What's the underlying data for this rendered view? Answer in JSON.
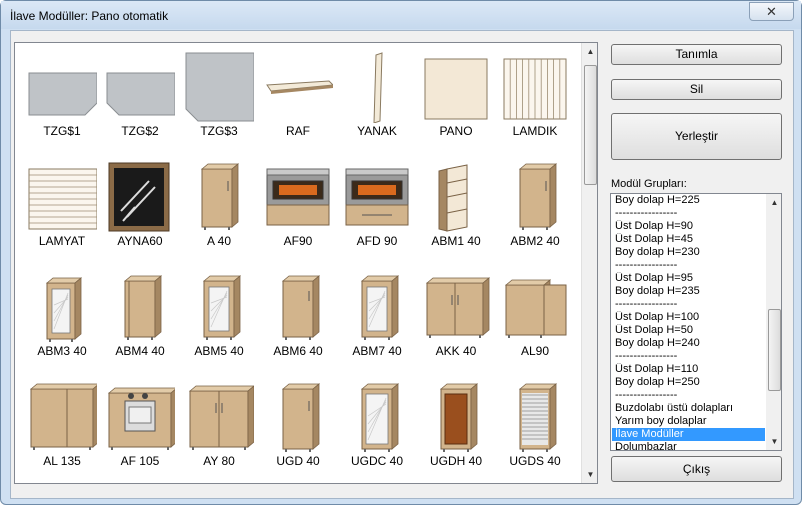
{
  "window": {
    "title": "İlave Modüller:  Pano otomatik",
    "close_glyph": "✕"
  },
  "buttons": {
    "tanimla": "Tanımla",
    "sil": "Sil",
    "yerlestir": "Yerleştir",
    "cikis": "Çıkış"
  },
  "groups": {
    "label": "Modül Grupları:",
    "items": [
      "Boy dolap H=225",
      "-----------------",
      "Üst Dolap H=90",
      "Üst Dolap H=45",
      "Boy dolap H=230",
      "-----------------",
      "Üst Dolap H=95",
      "Boy dolap H=235",
      "-----------------",
      "Üst Dolap H=100",
      "Üst Dolap H=50",
      "Boy dolap H=240",
      "-----------------",
      "Üst Dolap H=110",
      "Boy dolap H=250",
      "-----------------",
      "Buzdolabı üstü dolapları",
      "Yarım boy dolaplar",
      "İlave Modüller",
      "Dolumbazlar"
    ],
    "selected": "İlave Modüller"
  },
  "modules": [
    {
      "name": "TZG$1",
      "icon": "granite-countertop-icon",
      "kind": "granite1"
    },
    {
      "name": "TZG$2",
      "icon": "granite-countertop-icon",
      "kind": "granite2"
    },
    {
      "name": "TZG$3",
      "icon": "granite-countertop-icon",
      "kind": "granite3"
    },
    {
      "name": "RAF",
      "icon": "shelf-icon",
      "kind": "raf"
    },
    {
      "name": "YANAK",
      "icon": "side-panel-icon",
      "kind": "yanak"
    },
    {
      "name": "PANO",
      "icon": "panel-icon",
      "kind": "pano"
    },
    {
      "name": "LAMDIK",
      "icon": "vertical-lamel-icon",
      "kind": "lamdik"
    },
    {
      "name": "LAMYAT",
      "icon": "horizontal-lamel-icon",
      "kind": "lamyat"
    },
    {
      "name": "AYNA60",
      "icon": "mirror-icon",
      "kind": "ayna"
    },
    {
      "name": "A 40",
      "icon": "cabinet-icon",
      "kind": "a40"
    },
    {
      "name": "AF90",
      "icon": "oven-cabinet-icon",
      "kind": "af90"
    },
    {
      "name": "AFD 90",
      "icon": "oven-cabinet-icon",
      "kind": "afd90"
    },
    {
      "name": "ABM1 40",
      "icon": "open-shelf-cabinet-icon",
      "kind": "abm1"
    },
    {
      "name": "ABM2 40",
      "icon": "corner-cabinet-icon",
      "kind": "abm2"
    },
    {
      "name": "ABM3 40",
      "icon": "glass-cabinet-icon",
      "kind": "abm3"
    },
    {
      "name": "ABM4 40",
      "icon": "corner-cabinet-icon",
      "kind": "abm4"
    },
    {
      "name": "ABM5 40",
      "icon": "glass-corner-cabinet-icon",
      "kind": "abm5"
    },
    {
      "name": "ABM6 40",
      "icon": "cabinet-icon",
      "kind": "abm6"
    },
    {
      "name": "ABM7 40",
      "icon": "glass-cabinet-icon",
      "kind": "abm7"
    },
    {
      "name": "AKK 40",
      "icon": "double-cabinet-icon",
      "kind": "akk"
    },
    {
      "name": "AL90",
      "icon": "l-cabinet-icon",
      "kind": "al90"
    },
    {
      "name": "AL 135",
      "icon": "l-cabinet-icon",
      "kind": "al135"
    },
    {
      "name": "AF 105",
      "icon": "cooker-cabinet-icon",
      "kind": "af105"
    },
    {
      "name": "AY 80",
      "icon": "curved-cabinet-icon",
      "kind": "ay80"
    },
    {
      "name": "UGD 40",
      "icon": "cabinet-icon",
      "kind": "ugd"
    },
    {
      "name": "UGDC 40",
      "icon": "glass-cabinet-icon",
      "kind": "ugdc"
    },
    {
      "name": "UGDH 40",
      "icon": "rattan-cabinet-icon",
      "kind": "ugdh"
    },
    {
      "name": "UGDS  40",
      "icon": "shutter-cabinet-icon",
      "kind": "ugds"
    }
  ],
  "colors": {
    "wood": "#d2b48c",
    "wood_dark": "#a58762",
    "granite": "#bfc3c7",
    "selection": "#3399ff"
  }
}
